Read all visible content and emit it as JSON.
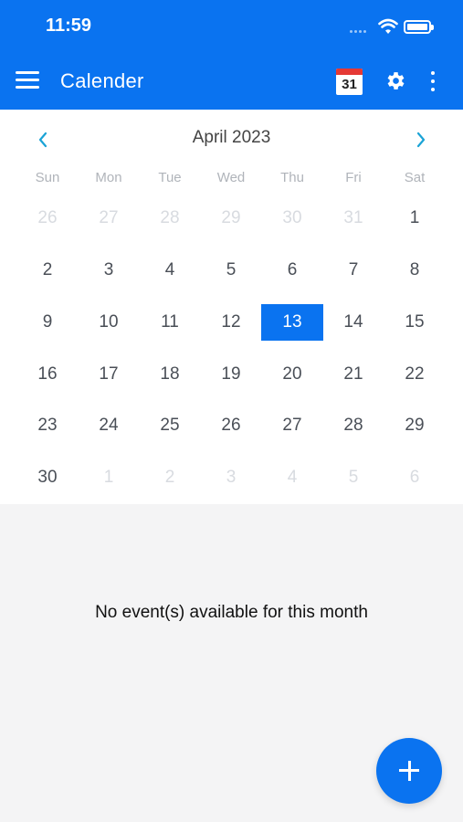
{
  "status_bar": {
    "time": "11:59"
  },
  "app_bar": {
    "title": "Calender",
    "calendar_icon_day": "31",
    "icons": [
      "menu-icon",
      "calendar-icon",
      "gear-icon",
      "more-vertical-icon"
    ]
  },
  "calendar": {
    "month_label": "April 2023",
    "weekdays": [
      "Sun",
      "Mon",
      "Tue",
      "Wed",
      "Thu",
      "Fri",
      "Sat"
    ],
    "selected_day": "13",
    "weeks": [
      [
        {
          "d": "26",
          "m": true
        },
        {
          "d": "27",
          "m": true
        },
        {
          "d": "28",
          "m": true
        },
        {
          "d": "29",
          "m": true
        },
        {
          "d": "30",
          "m": true
        },
        {
          "d": "31",
          "m": true
        },
        {
          "d": "1",
          "m": false
        }
      ],
      [
        {
          "d": "2",
          "m": false
        },
        {
          "d": "3",
          "m": false
        },
        {
          "d": "4",
          "m": false
        },
        {
          "d": "5",
          "m": false
        },
        {
          "d": "6",
          "m": false
        },
        {
          "d": "7",
          "m": false
        },
        {
          "d": "8",
          "m": false
        }
      ],
      [
        {
          "d": "9",
          "m": false
        },
        {
          "d": "10",
          "m": false
        },
        {
          "d": "11",
          "m": false
        },
        {
          "d": "12",
          "m": false
        },
        {
          "d": "13",
          "m": false
        },
        {
          "d": "14",
          "m": false
        },
        {
          "d": "15",
          "m": false
        }
      ],
      [
        {
          "d": "16",
          "m": false
        },
        {
          "d": "17",
          "m": false
        },
        {
          "d": "18",
          "m": false
        },
        {
          "d": "19",
          "m": false
        },
        {
          "d": "20",
          "m": false
        },
        {
          "d": "21",
          "m": false
        },
        {
          "d": "22",
          "m": false
        }
      ],
      [
        {
          "d": "23",
          "m": false
        },
        {
          "d": "24",
          "m": false
        },
        {
          "d": "25",
          "m": false
        },
        {
          "d": "26",
          "m": false
        },
        {
          "d": "27",
          "m": false
        },
        {
          "d": "28",
          "m": false
        },
        {
          "d": "29",
          "m": false
        }
      ],
      [
        {
          "d": "30",
          "m": false
        },
        {
          "d": "1",
          "m": true
        },
        {
          "d": "2",
          "m": true
        },
        {
          "d": "3",
          "m": true
        },
        {
          "d": "4",
          "m": true
        },
        {
          "d": "5",
          "m": true
        },
        {
          "d": "6",
          "m": true
        }
      ]
    ]
  },
  "events": {
    "empty_message": "No event(s) available for this month"
  },
  "colors": {
    "primary": "#0a73f0",
    "muted_day": "#d8dbe0",
    "day_text": "#4a4f57"
  }
}
